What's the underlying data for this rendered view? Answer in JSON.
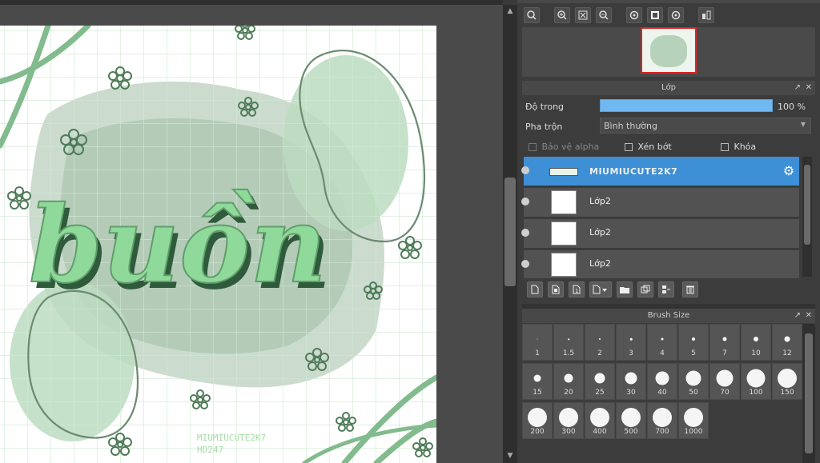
{
  "canvas": {
    "title_text": "buồn",
    "watermark_line1": "MIUMIUCUTE2K7",
    "watermark_line2": "HD247"
  },
  "navigator": {
    "toolbar": [
      "zoom-reset-icon",
      "zoom-in-icon",
      "fit-icon",
      "zoom-out-icon",
      "rotate-left-icon",
      "fullscreen-icon",
      "rotate-right-icon",
      "flip-icon"
    ]
  },
  "layers": {
    "panel_title": "Lớp",
    "opacity_label": "Độ trong",
    "opacity_value": 100,
    "opacity_text": "100 %",
    "blend_label": "Pha trộn",
    "blend_value": "Bình thường",
    "protect_alpha": "Bảo vệ alpha",
    "clipping": "Xén bớt",
    "lock": "Khóa",
    "items": [
      {
        "name": "MIUMIUCUTE2K7",
        "selected": true
      },
      {
        "name": "Lớp2",
        "selected": false
      },
      {
        "name": "Lớp2",
        "selected": false
      },
      {
        "name": "Lớp2",
        "selected": false
      }
    ],
    "bottom_icons": [
      "new-layer-icon",
      "new-layer-type-icon",
      "import-layer-icon",
      "add-layer-menu-icon",
      "folder-icon",
      "duplicate-icon",
      "merge-icon",
      "trash-icon"
    ]
  },
  "brush": {
    "panel_title": "Brush Size",
    "sizes": [
      "1",
      "1.5",
      "2",
      "3",
      "4",
      "5",
      "7",
      "10",
      "12",
      "15",
      "20",
      "25",
      "30",
      "40",
      "50",
      "70",
      "100",
      "150",
      "200",
      "300",
      "400",
      "500",
      "700",
      "1000"
    ]
  },
  "colors": {
    "accent": "#3d8fd6",
    "opacity_bar": "#6fb8f0",
    "canvas_green": "#8fc79a"
  }
}
